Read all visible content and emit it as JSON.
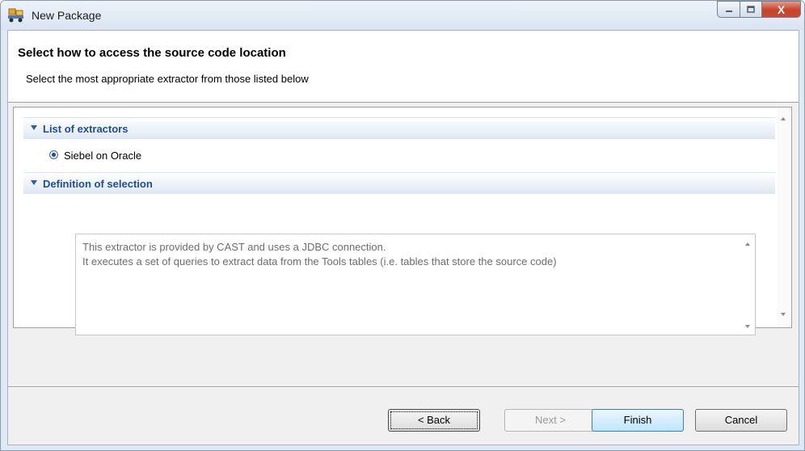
{
  "window": {
    "title": "New Package",
    "icon": "package-app-icon",
    "controls": [
      "minimize-icon",
      "maximize-icon",
      "close-icon"
    ],
    "close_glyph": "X"
  },
  "header": {
    "title": "Select how to access the source code location",
    "subtitle": "Select the most appropriate extractor from those listed below"
  },
  "sections": {
    "extractors": {
      "label": "List of extractors",
      "options": [
        {
          "label": "Siebel on Oracle",
          "selected": true
        }
      ]
    },
    "definition": {
      "label": "Definition of selection",
      "lines": [
        "This extractor is provided by CAST and uses a JDBC connection.",
        "It executes a set of queries to extract data from the Tools tables (i.e. tables that store the source code)"
      ]
    }
  },
  "buttons": {
    "back": "< Back",
    "next": "Next >",
    "finish": "Finish",
    "cancel": "Cancel"
  },
  "colors": {
    "section_label": "#1f4e8f",
    "title_bar": "#dfe8f3",
    "close_button": "#c7422a"
  }
}
